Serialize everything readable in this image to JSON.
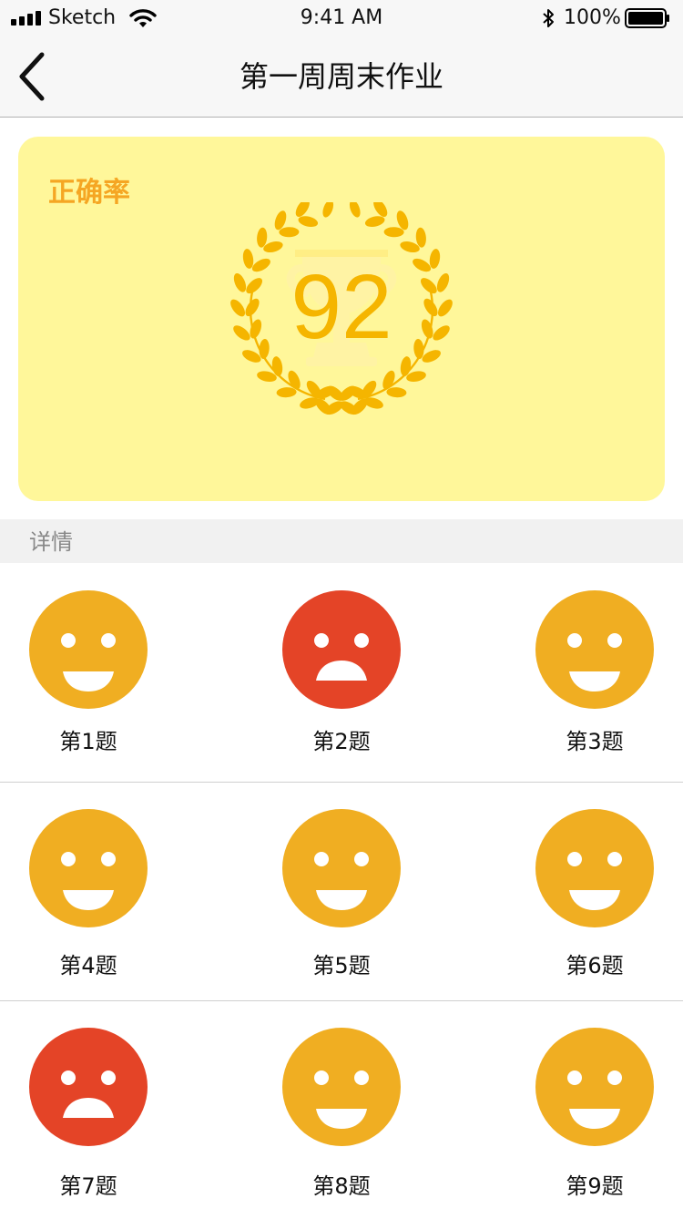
{
  "status_bar": {
    "carrier": "Sketch",
    "time": "9:41 AM",
    "battery": "100%"
  },
  "nav": {
    "title": "第一周周末作业",
    "back_icon": "chevron-left-icon"
  },
  "score_card": {
    "label": "正确率",
    "value": "92",
    "background": "#fff79a",
    "accent": "#f5b500"
  },
  "details": {
    "title": "详情"
  },
  "colors": {
    "correct": "#f0ae22",
    "wrong": "#e44427"
  },
  "questions": [
    {
      "label": "第1题",
      "status": "correct"
    },
    {
      "label": "第2题",
      "status": "wrong"
    },
    {
      "label": "第3题",
      "status": "correct"
    },
    {
      "label": "第4题",
      "status": "correct"
    },
    {
      "label": "第5题",
      "status": "correct"
    },
    {
      "label": "第6题",
      "status": "correct"
    },
    {
      "label": "第7题",
      "status": "wrong"
    },
    {
      "label": "第8题",
      "status": "correct"
    },
    {
      "label": "第9题",
      "status": "correct"
    }
  ]
}
